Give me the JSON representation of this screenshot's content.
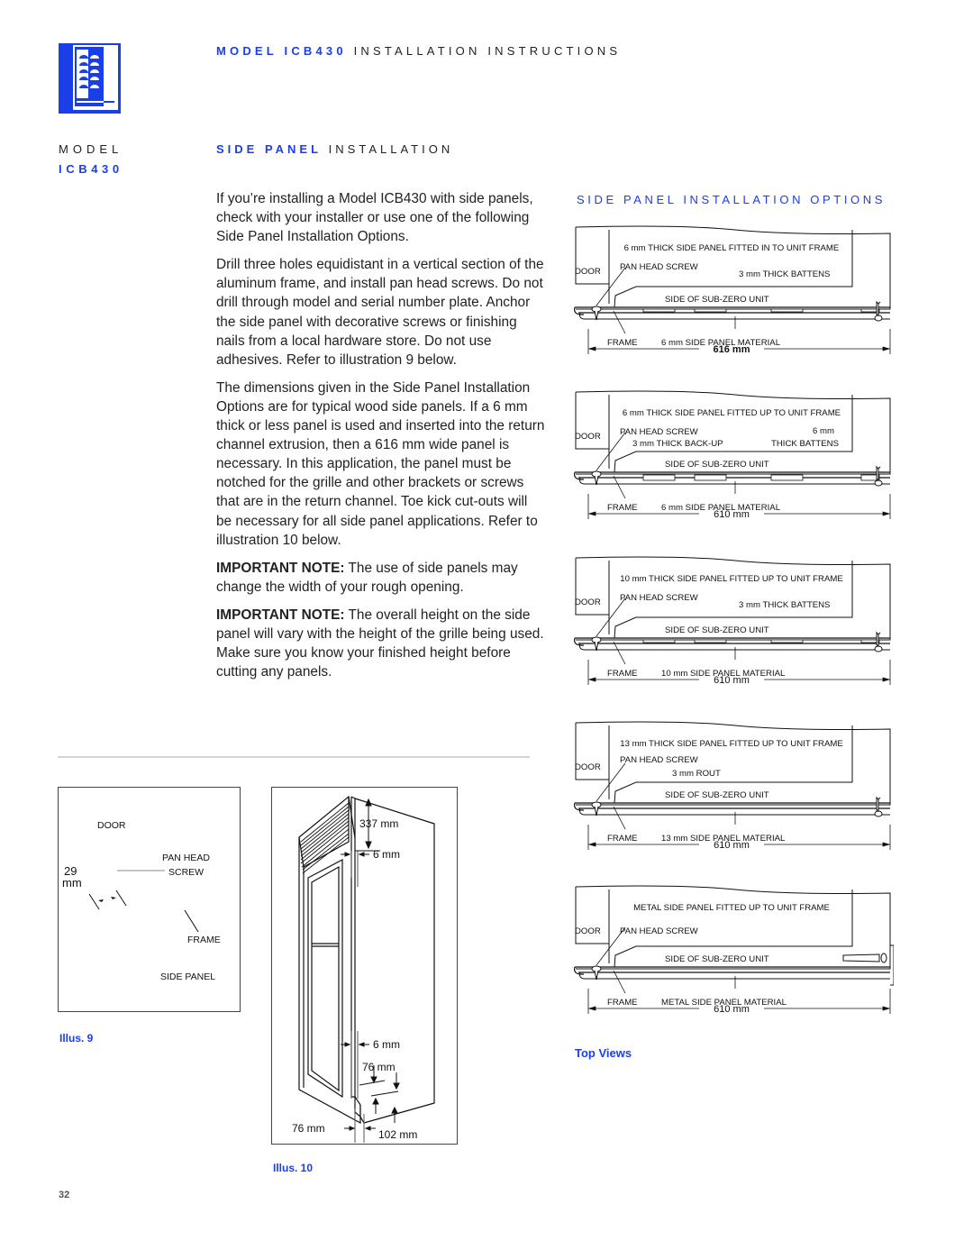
{
  "header": {
    "title_bold": "MODEL ICB430",
    "title_rest": " INSTALLATION INSTRUCTIONS"
  },
  "logo": {
    "icon": "wine-storage-unit-icon",
    "color": "#1a3fe6"
  },
  "sidebar": {
    "model_label": "MODEL",
    "model_number": "ICB430"
  },
  "section": {
    "title_bold": "SIDE PANEL",
    "title_rest": " INSTALLATION"
  },
  "body": {
    "paragraphs": [
      "If you’re installing a Model ICB430 with side panels, check with your installer or use one of the following Side Panel Installation Options.",
      "Drill three holes equidistant in a vertical section of the aluminum frame, and install pan head screws. Do not drill through model and serial number plate. Anchor the side panel with decorative screws or finishing nails from a local hardware store. Do not use adhesives. Refer to illustration 9 below.",
      "The dimensions given in the Side Panel Installation Options are for typical wood side panels. If a 6 mm thick or less panel is used and inserted into the return channel extrusion, then a 616 mm wide panel is necessary. In this application, the panel must be notched for the grille and other brackets or screws that are in the return channel. Toe kick cut-outs will be necessary for all side panel applications. Refer to illustration 10 below."
    ],
    "notes": [
      {
        "label": "IMPORTANT NOTE:",
        "text": " The use of side panels may change the width of your rough opening."
      },
      {
        "label": "IMPORTANT NOTE:",
        "text": " The overall height on the side panel will vary with the height of the grille being used. Make sure you know your finished height before cutting any panels."
      }
    ]
  },
  "options": {
    "title": "SIDE PANEL INSTALLATION OPTIONS",
    "diagrams": [
      {
        "heading": "6 mm THICK SIDE PANEL FITTED IN TO UNIT FRAME",
        "door": "DOOR",
        "screw": "PAN HEAD SCREW",
        "extra1": "",
        "extra2": "3 mm THICK BATTENS",
        "extra2b": "",
        "unit": "SIDE OF SUB-ZERO UNIT",
        "frame": "FRAME",
        "material": "6 mm SIDE PANEL MATERIAL",
        "width": "616 mm"
      },
      {
        "heading": "6 mm THICK SIDE PANEL FITTED UP TO UNIT FRAME",
        "door": "DOOR",
        "screw": "PAN HEAD SCREW",
        "extra1": "3 mm THICK BACK-UP",
        "extra2": "6 mm",
        "extra2b": "THICK BATTENS",
        "unit": "SIDE OF SUB-ZERO UNIT",
        "frame": "FRAME",
        "material": "6 mm SIDE PANEL MATERIAL",
        "width": "610 mm"
      },
      {
        "heading": "10 mm THICK SIDE PANEL FITTED UP TO UNIT FRAME",
        "door": "DOOR",
        "screw": "PAN HEAD SCREW",
        "extra1": "",
        "extra2": "3 mm THICK BATTENS",
        "extra2b": "",
        "unit": "SIDE OF SUB-ZERO UNIT",
        "frame": "FRAME",
        "material": "10 mm SIDE PANEL MATERIAL",
        "width": "610 mm"
      },
      {
        "heading": "13 mm THICK SIDE PANEL FITTED UP TO UNIT FRAME",
        "door": "DOOR",
        "screw": "PAN HEAD SCREW",
        "extra1": "3 mm ROUT",
        "extra2": "",
        "extra2b": "",
        "unit": "SIDE OF SUB-ZERO UNIT",
        "frame": "FRAME",
        "material": "13 mm SIDE PANEL MATERIAL",
        "width": "610 mm"
      },
      {
        "heading": "METAL SIDE PANEL FITTED UP TO UNIT FRAME",
        "door": "DOOR",
        "screw": "PAN HEAD SCREW",
        "extra1": "",
        "extra2": "",
        "extra2b": "",
        "unit": "SIDE OF SUB-ZERO UNIT",
        "frame": "FRAME",
        "material": "METAL SIDE PANEL MATERIAL",
        "width": "610 mm"
      }
    ],
    "caption": "Top Views"
  },
  "illus9": {
    "door": "DOOR",
    "pan_head": "PAN HEAD",
    "screw": "SCREW",
    "dim_value": "29",
    "dim_unit": "mm",
    "frame": "FRAME",
    "side_panel": "SIDE PANEL",
    "caption": "Illus. 9"
  },
  "illus10": {
    "top_height": "337 mm",
    "gap_top": "6 mm",
    "gap_bottom": "6 mm",
    "toe_height": "76 mm",
    "toe_depth": "76 mm",
    "base_height": "102 mm",
    "caption": "Illus. 10"
  },
  "footer": {
    "page_number": "32"
  }
}
